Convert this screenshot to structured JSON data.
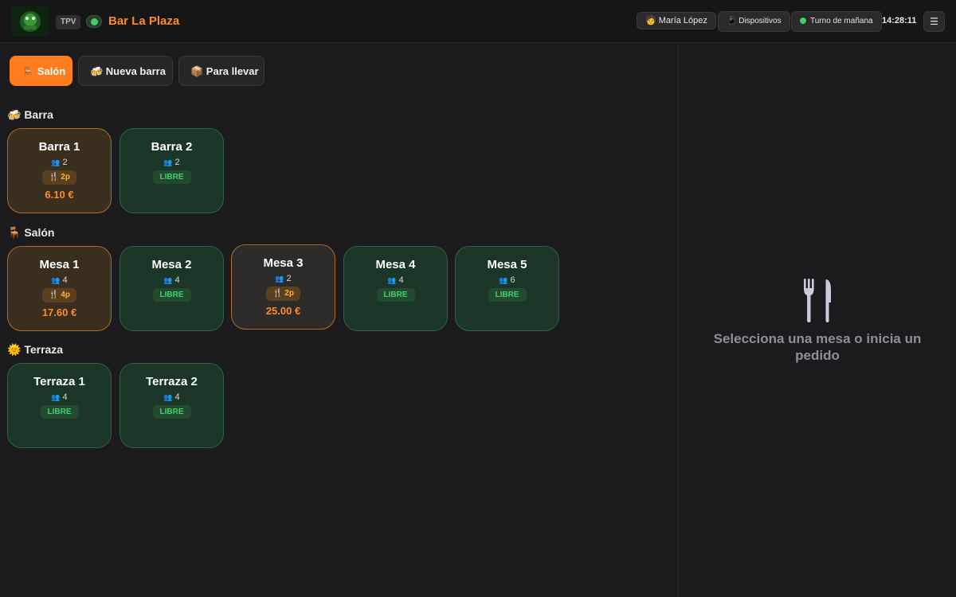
{
  "header": {
    "tpv_label": "TPV",
    "app_title": "Bar La Plaza",
    "user_label": "🧑 María López",
    "devices_label": "📱 Dispositivos",
    "shift_label": "Turno de mañana",
    "clock": "14:28:11",
    "menu_icon": "☰"
  },
  "tabs": [
    {
      "label": "🪑 Salón"
    },
    {
      "label": "🍻 Nueva barra"
    },
    {
      "label": "📦 Para llevar"
    }
  ],
  "sections": {
    "barra": "🍻 Barra",
    "salon": "🪑 Salón",
    "terraza": "🌞 Terraza"
  },
  "tables": {
    "barra1": {
      "name": "Barra 1",
      "seats": "2",
      "people": "🍴 2p",
      "total": "6.10 €"
    },
    "barra2": {
      "name": "Barra 2",
      "seats": "2",
      "status": "LIBRE"
    },
    "mesa1": {
      "name": "Mesa 1",
      "seats": "4",
      "people": "🍴 4p",
      "total": "17.60 €"
    },
    "mesa2": {
      "name": "Mesa 2",
      "seats": "4",
      "status": "LIBRE"
    },
    "mesa3": {
      "name": "Mesa 3",
      "seats": "2",
      "people": "🍴 2p",
      "total": "25.00 €"
    },
    "mesa4": {
      "name": "Mesa 4",
      "seats": "4",
      "status": "LIBRE"
    },
    "mesa5": {
      "name": "Mesa 5",
      "seats": "6",
      "status": "LIBRE"
    },
    "terraza1": {
      "name": "Terraza 1",
      "seats": "4",
      "status": "LIBRE"
    },
    "terraza2": {
      "name": "Terraza 2",
      "seats": "4",
      "status": "LIBRE"
    }
  },
  "seat_icon": "👥",
  "empty_state": {
    "text": "Selecciona una mesa o inicia un pedido"
  },
  "colors": {
    "accent": "#ff7d1f",
    "free": "#3fd06a",
    "occupied": "#b06a25"
  }
}
